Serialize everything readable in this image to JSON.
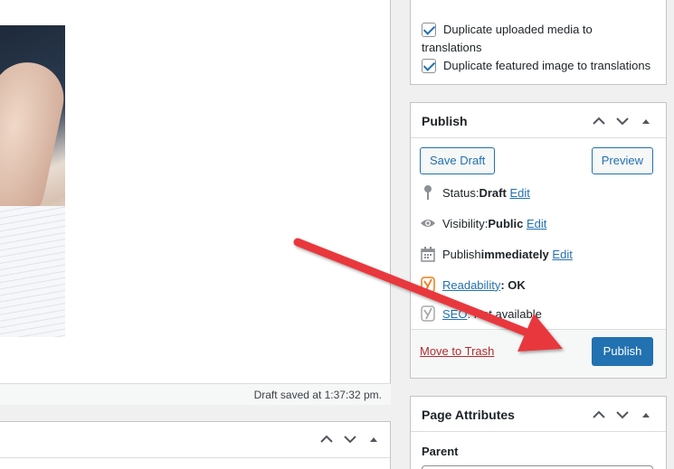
{
  "editor": {
    "status_text": "Draft saved at 1:37:32 pm."
  },
  "translations_panel": {
    "duplicate_media": "Duplicate uploaded media to translations",
    "duplicate_featured": "Duplicate featured image to translations"
  },
  "publish_panel": {
    "title": "Publish",
    "save_draft": "Save Draft",
    "preview": "Preview",
    "status_label": "Status: ",
    "status_value": "Draft",
    "visibility_label": "Visibility: ",
    "visibility_value": "Public",
    "publish_label": "Publish ",
    "publish_value": "immediately",
    "edit": "Edit",
    "readability_link": "Readability",
    "readability_value": ": OK",
    "seo_link": "SEO",
    "seo_value": ": Not available",
    "move_to_trash": "Move to Trash",
    "publish_button": "Publish"
  },
  "page_attributes_panel": {
    "title": "Page Attributes",
    "parent_label": "Parent"
  },
  "colors": {
    "primary": "#2271b1",
    "trash": "#b32d2e",
    "arrow": "#e8383d",
    "yoast_orange": "#ee7c1b"
  },
  "icons": [
    "pin-icon",
    "eye-icon",
    "calendar-icon",
    "yoast-readability-icon",
    "yoast-seo-icon",
    "chevron-up-icon",
    "chevron-down-icon",
    "triangle-up-icon"
  ]
}
